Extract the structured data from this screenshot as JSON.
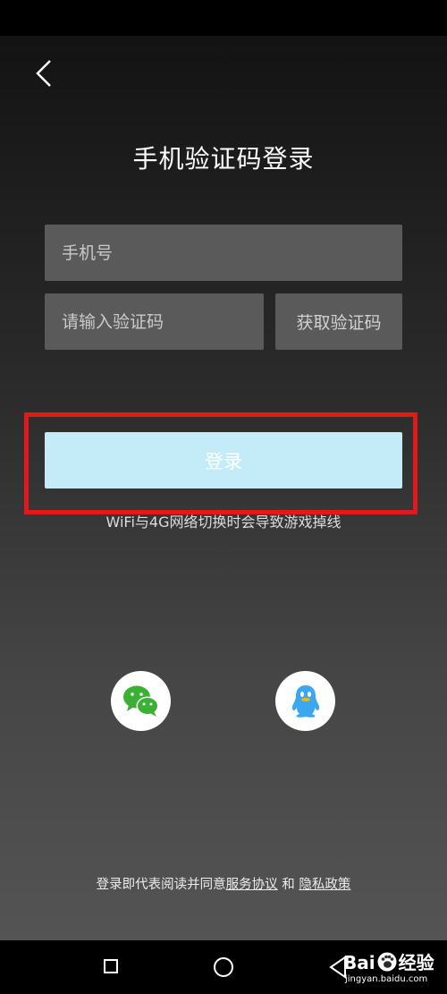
{
  "header": {
    "title": "手机验证码登录"
  },
  "form": {
    "phone_placeholder": "手机号",
    "code_placeholder": "请输入验证码",
    "get_code_label": "获取验证码",
    "login_label": "登录",
    "notice": "WiFi与4G网络切换时会导致游戏掉线"
  },
  "social": {
    "items": [
      {
        "name": "wechat",
        "icon": "wechat-icon",
        "color": "#3cb034"
      },
      {
        "name": "qq",
        "icon": "qq-penguin-icon",
        "color": "#3ba7ee"
      }
    ]
  },
  "agreement": {
    "prefix": "登录即代表阅读并同意",
    "service_link": "服务协议",
    "conjunction": " 和 ",
    "privacy_link": "隐私政策"
  },
  "watermark": {
    "text": "Bai",
    "text2": "经验",
    "url": "jingyan.baidu.com"
  },
  "colors": {
    "login_button": "#c3ebf8",
    "highlight_border": "#e0191e",
    "input_background": "#5a5a5a"
  }
}
